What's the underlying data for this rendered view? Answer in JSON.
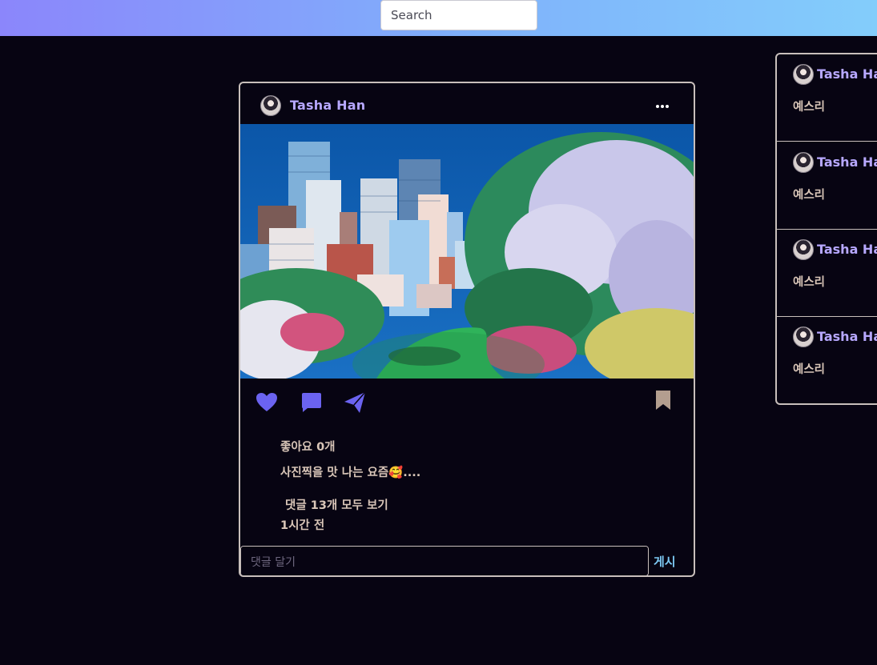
{
  "search": {
    "placeholder": "Search"
  },
  "post": {
    "username": "Tasha Han",
    "image_alt": "city skyline with blooming trees and park",
    "likes_text": "좋아요 0개",
    "caption": "사진찍을 맛 나는 요즘🥰....",
    "view_comments": "댓글 13개 모두 보기",
    "time_ago": "1시간 전",
    "comment_placeholder": "댓글 달기",
    "post_button": "게시",
    "icons": [
      "more-icon",
      "heart-icon",
      "comment-icon",
      "send-icon",
      "bookmark-icon"
    ]
  },
  "sidebar": {
    "items": [
      {
        "name": "Tasha Han",
        "text": "예스리"
      },
      {
        "name": "Tasha Han",
        "text": "예스리"
      },
      {
        "name": "Tasha Han",
        "text": "예스리"
      },
      {
        "name": "Tasha Han",
        "text": "예스리"
      }
    ]
  },
  "colors": {
    "background": "#070412",
    "accent": "#6b63f0",
    "username": "#b7a8ff",
    "post_button": "#7cc8f2",
    "bookmark": "#b39e8f",
    "text": "#d9c6b8"
  }
}
